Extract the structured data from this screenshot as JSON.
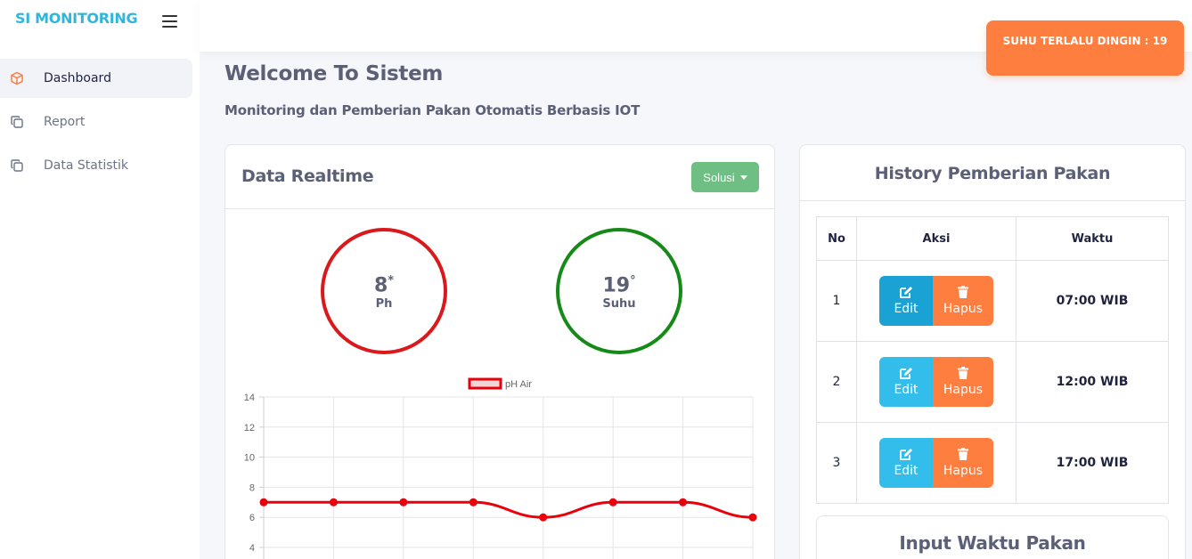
{
  "brand": "SI MONITORING",
  "sidebar": {
    "items": [
      {
        "label": "Dashboard",
        "icon": "box-icon"
      },
      {
        "label": "Report",
        "icon": "copy-icon"
      },
      {
        "label": "Data Statistik",
        "icon": "copy-icon"
      }
    ]
  },
  "alert": {
    "text": "SUHU TERLALU DINGIN : 19"
  },
  "page": {
    "title": "Welcome To Sistem",
    "subtitle": "Monitoring dan Pemberian Pakan Otomatis Berbasis IOT"
  },
  "realtime": {
    "title": "Data Realtime",
    "solusi_label": "Solusi",
    "ph": {
      "value": "8",
      "unit": "*",
      "label": "Ph",
      "color": "#d9191c"
    },
    "suhu": {
      "value": "19",
      "unit": "°",
      "label": "Suhu",
      "color": "#168a17"
    }
  },
  "chart_data": {
    "type": "line",
    "series": [
      {
        "name": "pH Air",
        "values": [
          7,
          7,
          7,
          7,
          6,
          7,
          7,
          6
        ],
        "color": "#e8000b"
      }
    ],
    "y_ticks": [
      4,
      6,
      8,
      10,
      12,
      14
    ],
    "ylim": [
      2,
      14
    ],
    "legend": "top-center",
    "grid": true
  },
  "history": {
    "title": "History Pemberian Pakan",
    "columns": [
      "No",
      "Aksi",
      "Waktu"
    ],
    "edit_label": "Edit",
    "hapus_label": "Hapus",
    "rows": [
      {
        "no": "1",
        "waktu": "07:00 WIB"
      },
      {
        "no": "2",
        "waktu": "12:00 WIB"
      },
      {
        "no": "3",
        "waktu": "17:00 WIB"
      }
    ]
  },
  "input_waktu": {
    "title": "Input Waktu Pakan"
  }
}
